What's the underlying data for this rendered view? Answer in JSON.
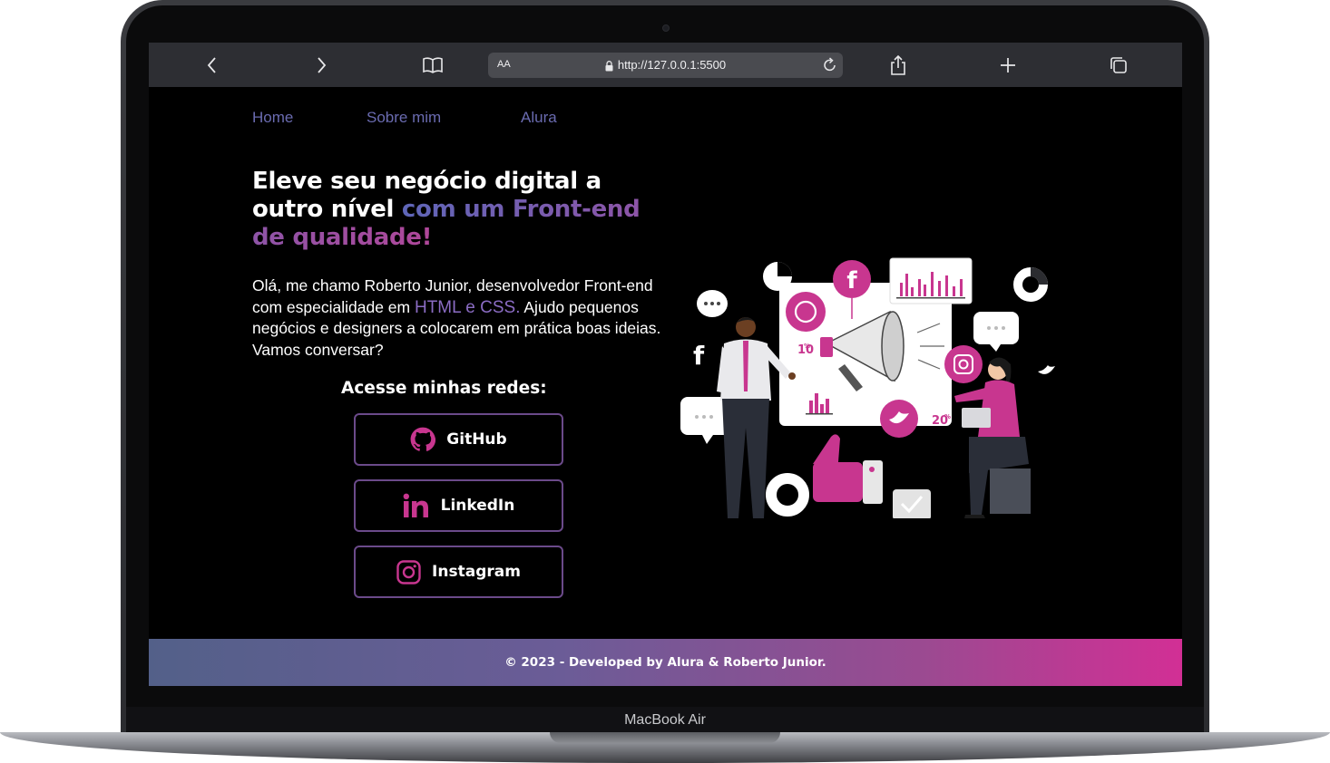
{
  "device": {
    "label": "MacBook Air"
  },
  "browser": {
    "text_size_button": "AA",
    "url": "http://127.0.0.1:5500",
    "icons": [
      "back-icon",
      "forward-icon",
      "bookmarks-icon",
      "lock-icon",
      "reload-icon",
      "share-icon",
      "new-tab-icon",
      "tabs-icon"
    ]
  },
  "nav": {
    "items": [
      {
        "label": "Home"
      },
      {
        "label": "Sobre mim"
      },
      {
        "label": "Alura"
      }
    ]
  },
  "hero": {
    "headline_plain": "Eleve seu negócio digital a outro nível ",
    "headline_accent": "com um Front-end de qualidade!",
    "intro_part1": "Olá, me chamo Roberto Junior, desenvolvedor Front-end com especialidade em ",
    "intro_accent": "HTML e CSS.",
    "intro_part2": " Ajudo pequenos negócios e designers a colocarem em prática boas ideias. Vamos conversar?"
  },
  "social": {
    "title": "Acesse minhas redes:",
    "buttons": [
      {
        "label": "GitHub",
        "icon": "github-icon"
      },
      {
        "label": "LinkedIn",
        "icon": "linkedin-icon"
      },
      {
        "label": "Instagram",
        "icon": "instagram-icon"
      }
    ]
  },
  "illustration": {
    "badge_left": "10",
    "badge_right": "20"
  },
  "footer": {
    "text": "© 2023 - Developed by Alura & Roberto Junior."
  },
  "colors": {
    "accent_pink": "#d22f95",
    "accent_purple": "#6a6bb0",
    "background": "#000000",
    "button_border": "#6b4a8a"
  }
}
